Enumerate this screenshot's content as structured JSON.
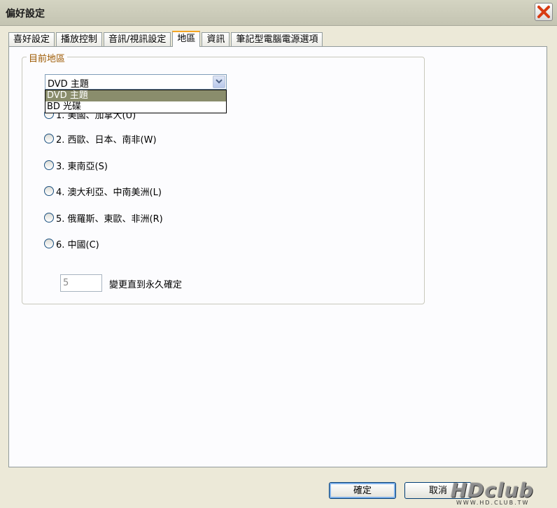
{
  "window": {
    "title": "偏好設定"
  },
  "tabs": [
    "喜好設定",
    "播放控制",
    "音訊/視訊設定",
    "地區",
    "資訊",
    "筆記型電腦電源選項"
  ],
  "active_tab": "地區",
  "group": {
    "label": "目前地區"
  },
  "combo": {
    "value": "DVD 主題",
    "options": [
      "DVD 主題",
      "BD 光碟"
    ],
    "selected": "DVD 主題"
  },
  "regions": [
    "1. 美國、加拿大(U)",
    "2. 西歐、日本、南非(W)",
    "3. 東南亞(S)",
    "4. 澳大利亞、中南美洲(L)",
    "5. 俄羅斯、東歐、非洲(R)",
    "6. 中國(C)"
  ],
  "change_count": {
    "value": "5",
    "label": "變更直到永久確定"
  },
  "buttons": {
    "ok": "確定",
    "cancel": "取消"
  },
  "watermark": {
    "text": "HDclub",
    "url": "WWW.HD.CLUB.TW"
  },
  "colors": {
    "accent_tab": "#f5a623",
    "group_label": "#9c5900",
    "dropdown_selected": "#8a8d6c"
  }
}
